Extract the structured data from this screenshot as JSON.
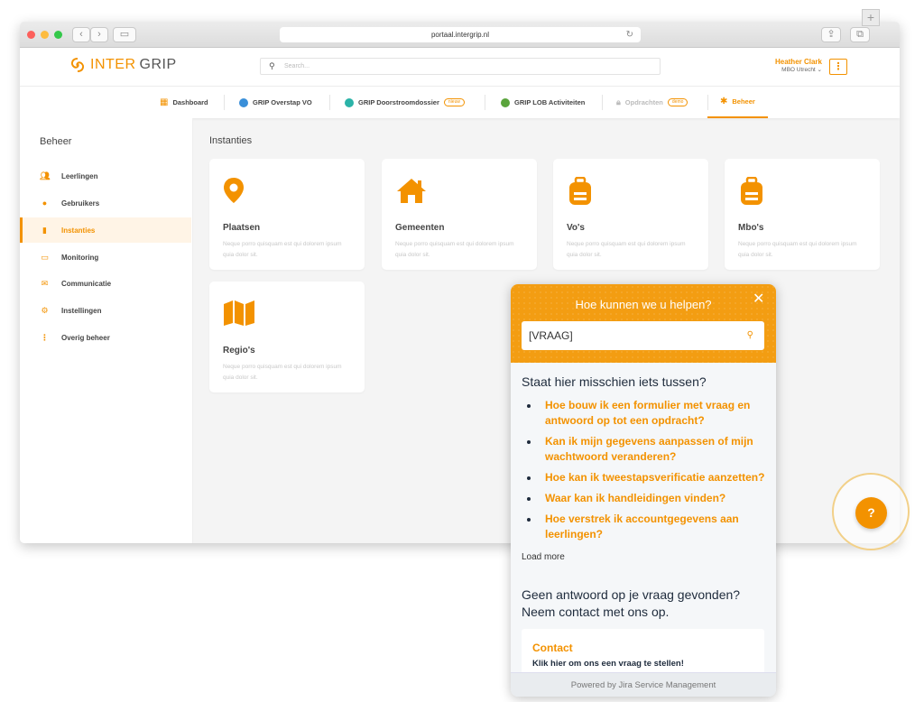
{
  "browser": {
    "url": "portaal.intergrip.nl"
  },
  "header": {
    "logo_part1": "INTER",
    "logo_part2": "GRIP",
    "search_placeholder": "Search...",
    "user_name": "Heather Clark",
    "user_org": "MBO Utrecht ⌄",
    "menu_icon": "⋮"
  },
  "nav": {
    "tabs": [
      {
        "label": "Dashboard"
      },
      {
        "label": "GRIP Overstap VO"
      },
      {
        "label": "GRIP Doorstroomdossier",
        "badge": "nieuw"
      },
      {
        "label": "GRIP LOB Activiteiten"
      },
      {
        "label": "Opdrachten",
        "badge": "demo"
      },
      {
        "label": "Beheer"
      }
    ]
  },
  "sidebar": {
    "title": "Beheer",
    "items": [
      {
        "label": "Leerlingen"
      },
      {
        "label": "Gebruikers"
      },
      {
        "label": "Instanties"
      },
      {
        "label": "Monitoring"
      },
      {
        "label": "Communicatie"
      },
      {
        "label": "Instellingen"
      },
      {
        "label": "Overig beheer"
      }
    ]
  },
  "main": {
    "title": "Instanties",
    "cards": [
      {
        "title": "Plaatsen",
        "desc": "Neque porro quisquam est qui dolorem ipsum quia dolor sit."
      },
      {
        "title": "Gemeenten",
        "desc": "Neque porro quisquam est qui dolorem ipsum quia dolor sit."
      },
      {
        "title": "Vo's",
        "desc": "Neque porro quisquam est qui dolorem ipsum quia dolor sit."
      },
      {
        "title": "Mbo's",
        "desc": "Neque porro quisquam est qui dolorem ipsum quia dolor sit."
      },
      {
        "title": "Regio's",
        "desc": "Neque porro quisquam est qui dolorem ipsum quia dolor sit."
      }
    ]
  },
  "widget": {
    "title": "Hoe kunnen we u helpen?",
    "input_value": "[VRAAG]",
    "suggest_title": "Staat hier misschien iets tussen?",
    "suggestions": [
      "Hoe bouw ik een formulier met vraag en antwoord op tot een opdracht?",
      "Kan ik mijn gegevens aanpassen of mijn wachtwoord veranderen?",
      "Hoe kan ik tweestapsverificatie aanzetten?",
      "Waar kan ik handleidingen vinden?",
      "Hoe verstrek ik accountgegevens aan leerlingen?"
    ],
    "load_more": "Load more",
    "no_answer": "Geen antwoord op je vraag gevonden? Neem contact met ons op.",
    "contact_title": "Contact",
    "contact_desc": "Klik hier om ons een vraag te stellen!",
    "footer": "Powered by Jira Service Management"
  },
  "help_button": {
    "label": "?"
  },
  "colors": {
    "accent": "#f39200",
    "header": "#f39d12"
  }
}
